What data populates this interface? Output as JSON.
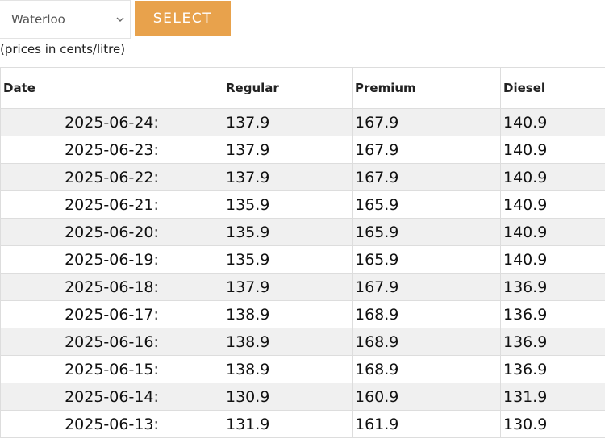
{
  "controls": {
    "location_selected": "Waterloo",
    "select_button_label": "SELECT",
    "accent_color": "#e8a24c"
  },
  "units_note": "(prices in cents/litre)",
  "table": {
    "headers": [
      "Date",
      "Regular",
      "Premium",
      "Diesel"
    ],
    "rows": [
      {
        "date": "2025-06-24:",
        "regular": "137.9",
        "premium": "167.9",
        "diesel": "140.9"
      },
      {
        "date": "2025-06-23:",
        "regular": "137.9",
        "premium": "167.9",
        "diesel": "140.9"
      },
      {
        "date": "2025-06-22:",
        "regular": "137.9",
        "premium": "167.9",
        "diesel": "140.9"
      },
      {
        "date": "2025-06-21:",
        "regular": "135.9",
        "premium": "165.9",
        "diesel": "140.9"
      },
      {
        "date": "2025-06-20:",
        "regular": "135.9",
        "premium": "165.9",
        "diesel": "140.9"
      },
      {
        "date": "2025-06-19:",
        "regular": "135.9",
        "premium": "165.9",
        "diesel": "140.9"
      },
      {
        "date": "2025-06-18:",
        "regular": "137.9",
        "premium": "167.9",
        "diesel": "136.9"
      },
      {
        "date": "2025-06-17:",
        "regular": "138.9",
        "premium": "168.9",
        "diesel": "136.9"
      },
      {
        "date": "2025-06-16:",
        "regular": "138.9",
        "premium": "168.9",
        "diesel": "136.9"
      },
      {
        "date": "2025-06-15:",
        "regular": "138.9",
        "premium": "168.9",
        "diesel": "136.9"
      },
      {
        "date": "2025-06-14:",
        "regular": "130.9",
        "premium": "160.9",
        "diesel": "131.9"
      },
      {
        "date": "2025-06-13:",
        "regular": "131.9",
        "premium": "161.9",
        "diesel": "130.9"
      }
    ]
  }
}
